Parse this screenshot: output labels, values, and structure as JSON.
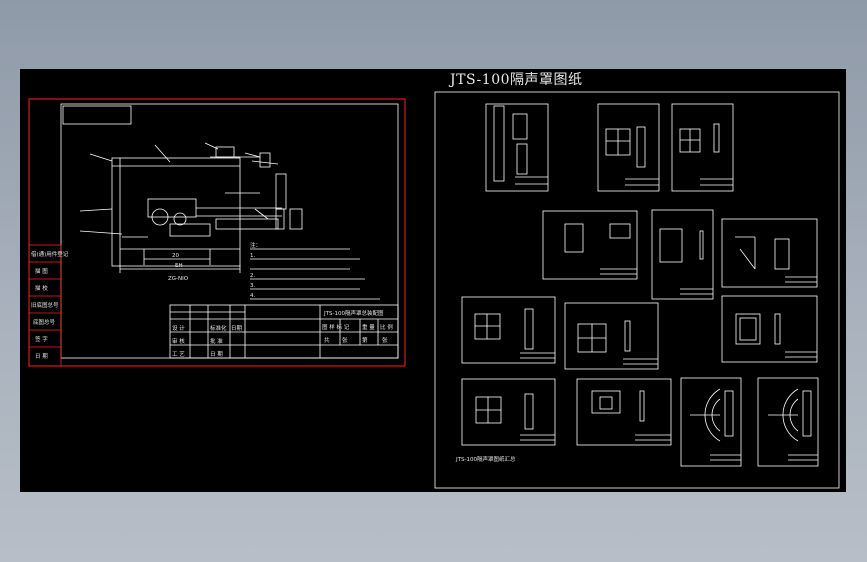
{
  "window": {
    "background_top": "#8f9aa8",
    "background_bottom": "#b7bec7"
  },
  "drawing": {
    "title": "JTS-100隔声罩图纸",
    "colors": {
      "canvas": "#000000",
      "red_frame": "#ff2020",
      "line": "#ffffff",
      "text": "#e6e6e6"
    },
    "left_sheet": {
      "side_labels": [
        "借(通)用件登记",
        "描 图",
        "描 校",
        "旧底图总号",
        "底图总号",
        "签 字",
        "日 期"
      ],
      "dims": [
        "ZG-NIO",
        "EH",
        "20"
      ],
      "notes": [
        "注：",
        "1.",
        "2.",
        "3.",
        "4."
      ],
      "title_block": {
        "row1": [
          "设 计",
          "标准化",
          "日期"
        ],
        "row2": [
          "审 核",
          "批 准"
        ],
        "row3": [
          "工 艺",
          "日 期"
        ],
        "right_title": "JTS-100隔声罩总装配图",
        "right_row": [
          "图 样 标 记",
          "重 量",
          "比 例"
        ],
        "right_row2": [
          "共",
          "张",
          "第",
          "张"
        ]
      }
    },
    "right_sheet": {
      "bottom_note": "JTS-100隔声罩图纸汇总"
    }
  }
}
